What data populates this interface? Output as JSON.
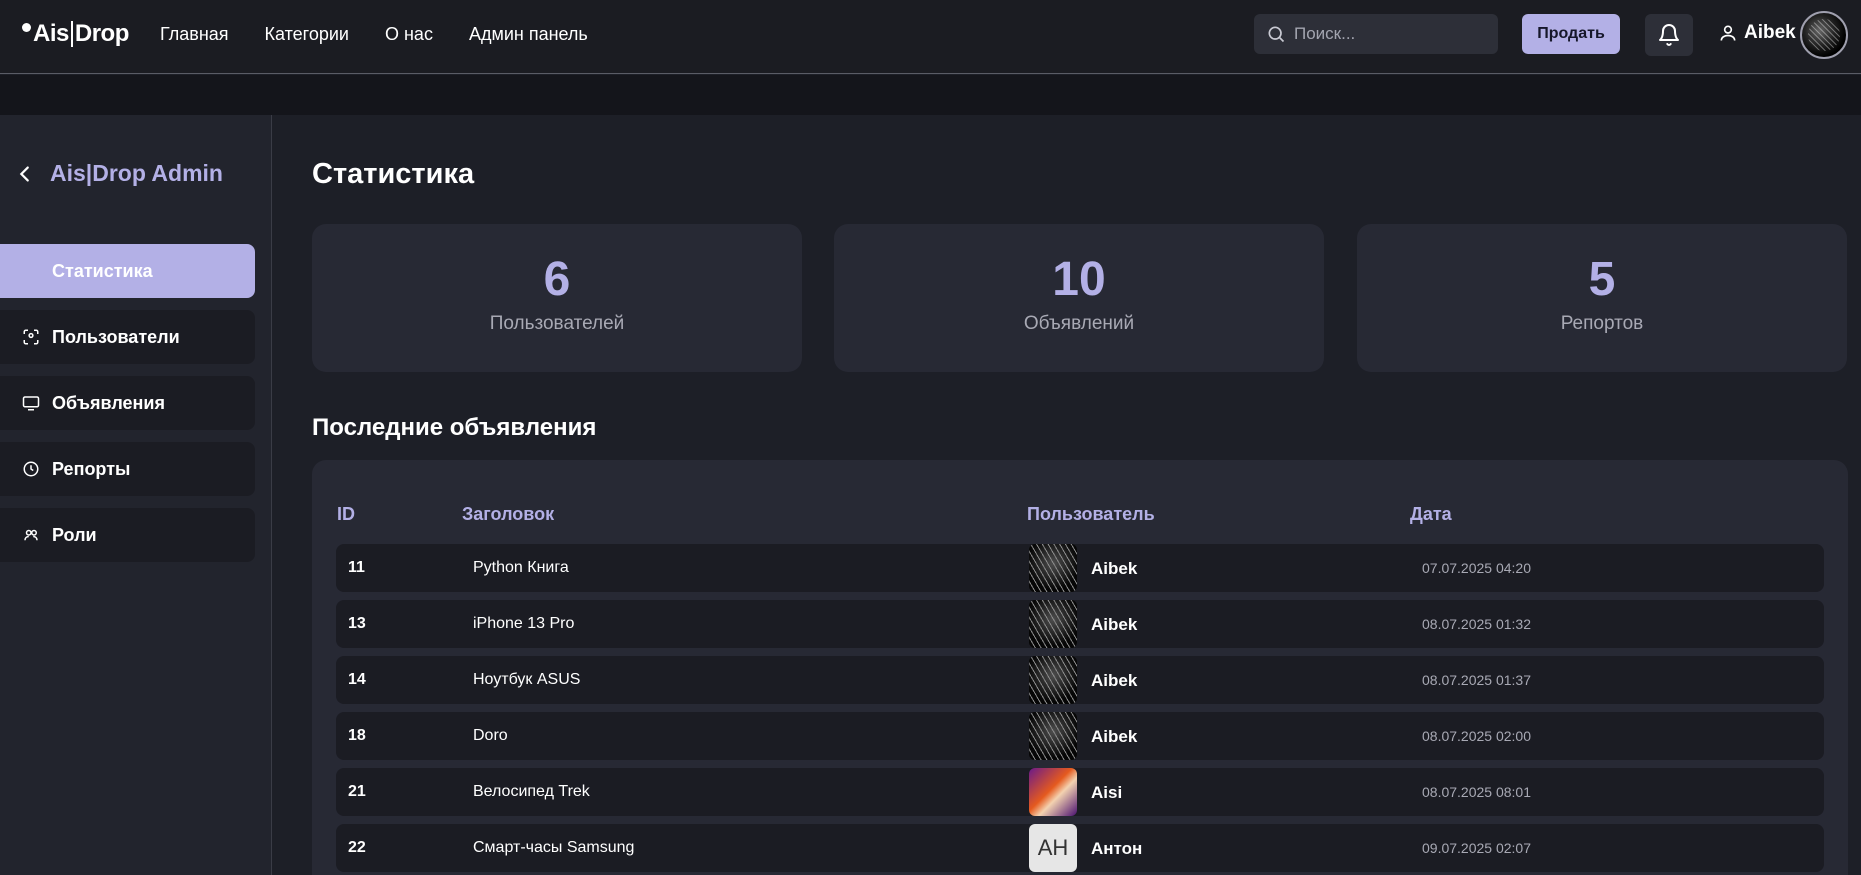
{
  "header": {
    "logo_left": "Ais",
    "logo_right": "Drop",
    "nav": [
      "Главная",
      "Категории",
      "О нас",
      "Админ панель"
    ],
    "search_placeholder": "Поиск...",
    "sell_label": "Продать",
    "username": "Aibek"
  },
  "sidebar": {
    "title": "Ais|Drop Admin",
    "items": [
      {
        "label": "Статистика",
        "icon": "none",
        "active": true
      },
      {
        "label": "Пользователи",
        "icon": "users-icon"
      },
      {
        "label": "Объявления",
        "icon": "monitor-icon"
      },
      {
        "label": "Репорты",
        "icon": "clock-icon"
      },
      {
        "label": "Роли",
        "icon": "roles-icon"
      }
    ]
  },
  "main": {
    "title": "Статистика",
    "stats": [
      {
        "value": "6",
        "label": "Пользователей"
      },
      {
        "value": "10",
        "label": "Объявлений"
      },
      {
        "value": "5",
        "label": "Репортов"
      }
    ],
    "section_title": "Последние объявления",
    "table": {
      "headers": [
        "ID",
        "Заголовок",
        "Пользователь",
        "Дата"
      ],
      "rows": [
        {
          "id": "11",
          "title": "Python Книга",
          "user": "Aibek",
          "avatar": "photo",
          "date": "07.07.2025 04:20"
        },
        {
          "id": "13",
          "title": "iPhone 13 Pro",
          "user": "Aibek",
          "avatar": "photo",
          "date": "08.07.2025 01:32"
        },
        {
          "id": "14",
          "title": "Ноутбук ASUS",
          "user": "Aibek",
          "avatar": "photo",
          "date": "08.07.2025 01:37"
        },
        {
          "id": "18",
          "title": "Doro",
          "user": "Aibek",
          "avatar": "photo",
          "date": "08.07.2025 02:00"
        },
        {
          "id": "21",
          "title": "Велосипед Trek",
          "user": "Aisi",
          "avatar": "anime",
          "date": "08.07.2025 08:01"
        },
        {
          "id": "22",
          "title": "Смарт-часы Samsung",
          "user": "Антон",
          "avatar": "initials",
          "initials": "АН",
          "date": "09.07.2025 02:07"
        }
      ]
    }
  },
  "colors": {
    "accent": "#b3b0e6",
    "bg": "#1d1f27",
    "card": "#272934"
  }
}
